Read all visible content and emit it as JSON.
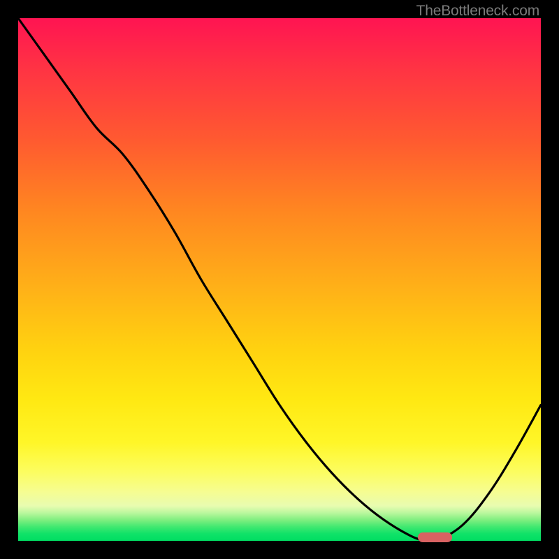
{
  "watermark": "TheBottleneck.com",
  "colors": {
    "curve": "#000000",
    "marker": "#d96262",
    "frame_bg": "#000000"
  },
  "chart_data": {
    "type": "line",
    "title": "",
    "xlabel": "",
    "ylabel": "",
    "xlim": [
      0,
      100
    ],
    "ylim": [
      0,
      100
    ],
    "gradient_note": "background is a vertical red→orange→yellow→green heat gradient (0 = green bottom, 100 = red top)",
    "series": [
      {
        "name": "bottleneck-curve",
        "x": [
          0,
          5,
          10,
          15,
          20,
          25,
          30,
          35,
          40,
          45,
          50,
          55,
          60,
          65,
          70,
          75,
          78,
          80,
          85,
          90,
          95,
          100
        ],
        "y": [
          100,
          93,
          86,
          79,
          74,
          67,
          59,
          50,
          42,
          34,
          26,
          19,
          13,
          8,
          4,
          1,
          0,
          0,
          3,
          9,
          17,
          26
        ]
      }
    ],
    "marker": {
      "name": "optimal-range",
      "x_start": 76.5,
      "x_end": 83,
      "y": 0.7
    }
  }
}
